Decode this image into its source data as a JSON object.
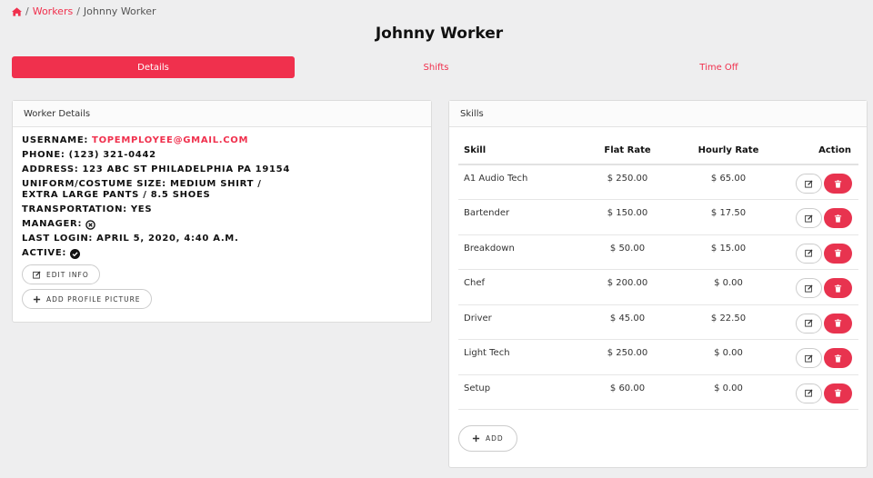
{
  "breadcrumb": {
    "workers": "Workers",
    "current": "Johnny Worker"
  },
  "page": {
    "title": "Johnny Worker"
  },
  "tabs": [
    {
      "label": "Details",
      "active": true
    },
    {
      "label": "Shifts",
      "active": false
    },
    {
      "label": "Time Off",
      "active": false
    }
  ],
  "worker_card": {
    "title": "Worker Details",
    "username_label": "Username:",
    "username": "topemployee@gmail.com",
    "phone_label": "Phone:",
    "phone": "(123) 321-0442",
    "address_label": "Address:",
    "address": "123 ABC St Philadelphia PA 19154",
    "uniform_label": "Uniform/Costume Size:",
    "uniform_line1": "Medium Shirt /",
    "uniform_line2": "Extra Large Pants / 8.5 Shoes",
    "transport_label": "Transportation:",
    "transport": "Yes",
    "manager_label": "Manager:",
    "last_login_label": "Last Login:",
    "last_login": "April 5, 2020, 4:40 a.m.",
    "active_label": "Active:",
    "edit_info": "Edit Info",
    "add_picture": "Add Profile Picture"
  },
  "skills_card": {
    "title": "Skills",
    "headers": {
      "skill": "Skill",
      "flat": "Flat Rate",
      "hourly": "Hourly Rate",
      "action": "Action"
    },
    "rows": [
      {
        "skill": "A1 Audio Tech",
        "flat": "$ 250.00",
        "hourly": "$ 65.00"
      },
      {
        "skill": "Bartender",
        "flat": "$ 150.00",
        "hourly": "$ 17.50"
      },
      {
        "skill": "Breakdown",
        "flat": "$ 50.00",
        "hourly": "$ 15.00"
      },
      {
        "skill": "Chef",
        "flat": "$ 200.00",
        "hourly": "$ 0.00"
      },
      {
        "skill": "Driver",
        "flat": "$ 45.00",
        "hourly": "$ 22.50"
      },
      {
        "skill": "Light Tech",
        "flat": "$ 250.00",
        "hourly": "$ 0.00"
      },
      {
        "skill": "Setup",
        "flat": "$ 60.00",
        "hourly": "$ 0.00"
      }
    ],
    "add_label": "Add"
  },
  "colors": {
    "accent": "#f0304d",
    "danger": "#e8334f",
    "background": "#eeeeef"
  }
}
